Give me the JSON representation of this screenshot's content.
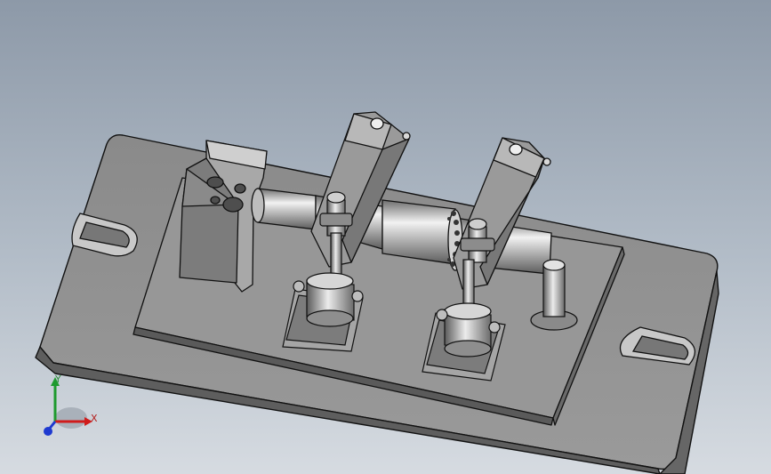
{
  "viewport": {
    "background_top": "#8d99a8",
    "background_bottom": "#d6dbe1",
    "model_color": "#8e8e8e",
    "edge_color": "#111111"
  },
  "triad": {
    "x_label": "X",
    "y_label": "Y",
    "x_color": "#d01c1c",
    "y_color": "#1e9a2e",
    "z_color": "#1e3ad0"
  }
}
